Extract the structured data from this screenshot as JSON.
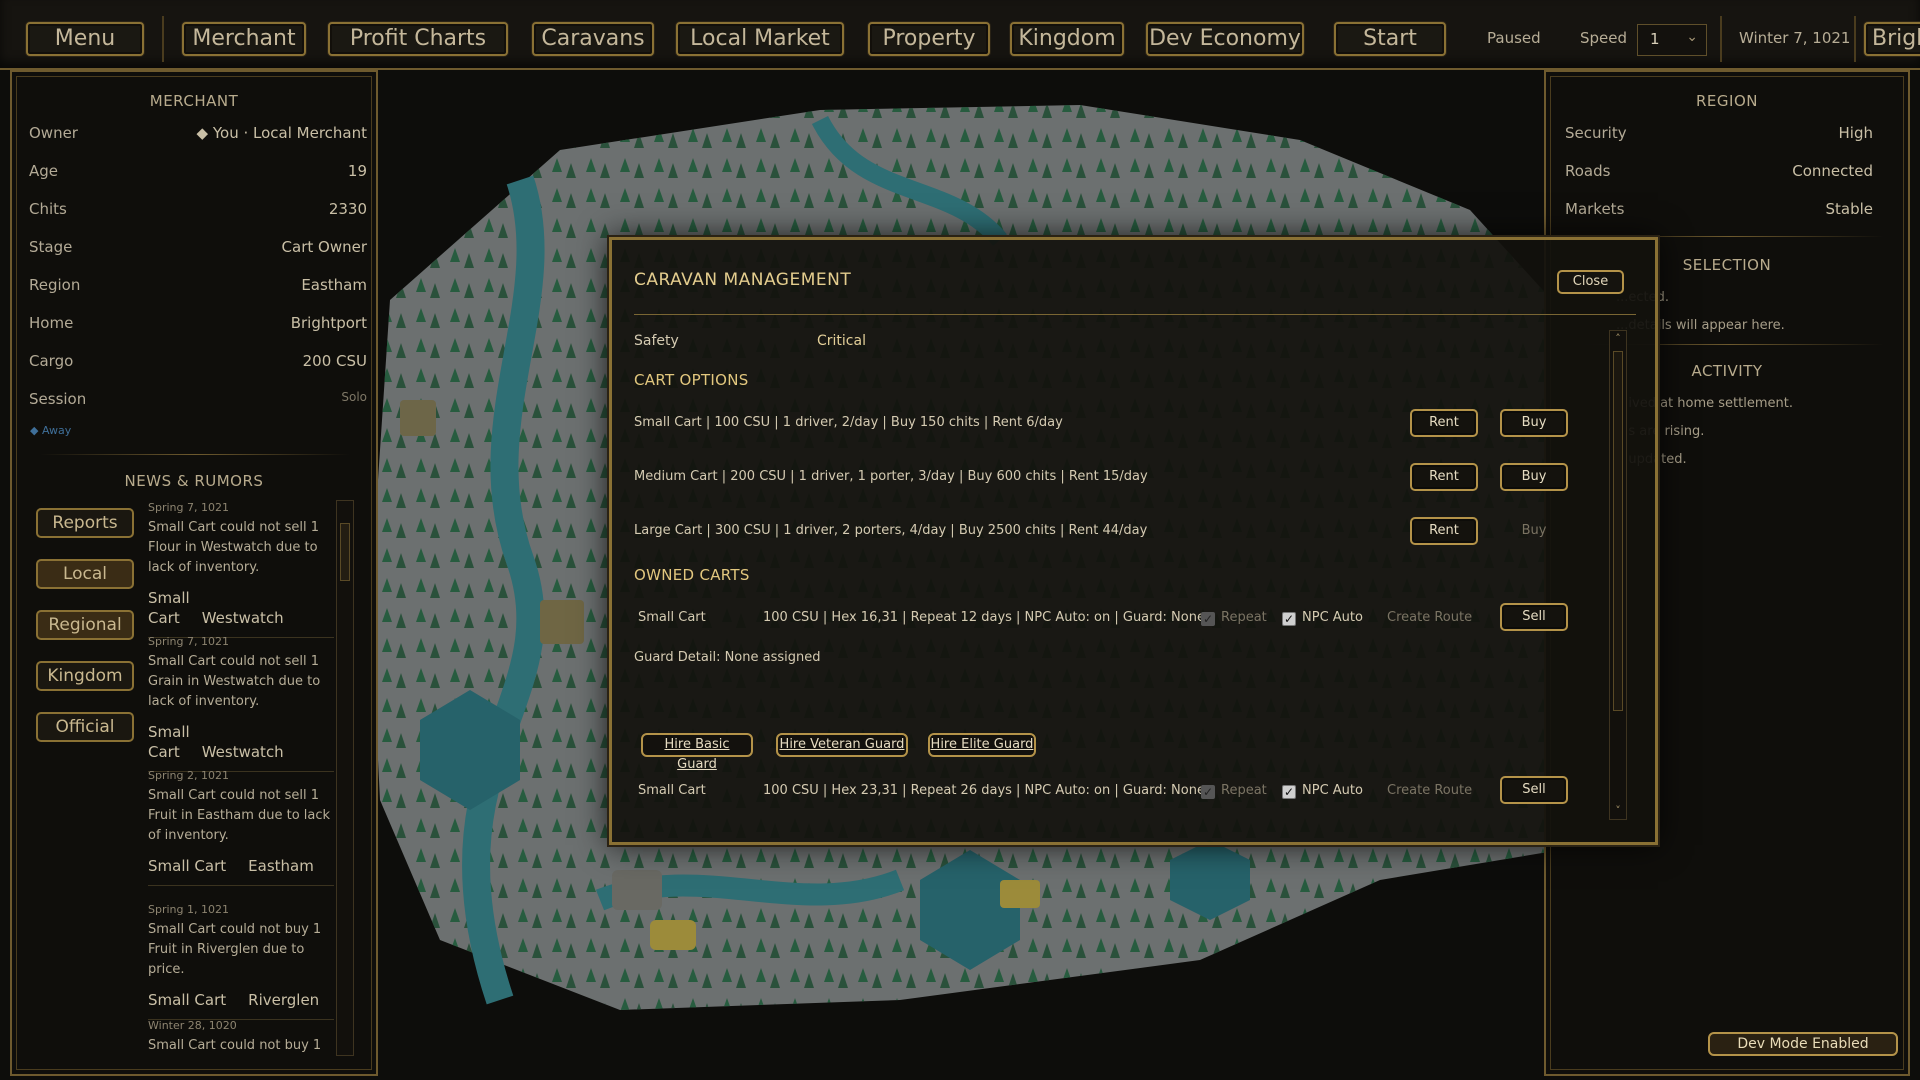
{
  "topbar": {
    "nav": [
      "Menu",
      "Merchant",
      "Profit Charts",
      "Caravans",
      "Local Market",
      "Property",
      "Kingdom",
      "Dev Economy",
      "Start"
    ],
    "status": "Paused",
    "speed_label": "Speed",
    "speed_value": "1",
    "date": "Winter 7, 1021",
    "location_partial": "Brigh"
  },
  "merchant": {
    "heading": "MERCHANT",
    "rows": [
      {
        "k": "Owner",
        "v": "◆ You · Local Merchant"
      },
      {
        "k": "Age",
        "v": "19"
      },
      {
        "k": "Chits",
        "v": "2330"
      },
      {
        "k": "Stage",
        "v": "Cart Owner"
      },
      {
        "k": "Region",
        "v": "Eastham"
      },
      {
        "k": "Home",
        "v": "Brightport"
      },
      {
        "k": "Cargo",
        "v": "200 CSU"
      },
      {
        "k": "Session",
        "v": "Solo"
      }
    ],
    "away": "◆ Away"
  },
  "news": {
    "heading": "NEWS & RUMORS",
    "filters": [
      "Reports",
      "Local",
      "Regional",
      "Kingdom",
      "Official"
    ],
    "items": [
      {
        "date": "Spring 7, 1021",
        "text": "Small Cart could not sell 1 Flour in Westwatch due to lack of inventory.",
        "tags": [
          "Small Cart",
          "Westwatch"
        ]
      },
      {
        "date": "Spring 7, 1021",
        "text": "Small Cart could not sell 1 Grain in Westwatch due to lack of inventory.",
        "tags": [
          "Small Cart",
          "Westwatch"
        ]
      },
      {
        "date": "Spring 2, 1021",
        "text": "Small Cart could not sell 1 Fruit in Eastham due to lack of inventory.",
        "tags": [
          "Small Cart",
          "Eastham"
        ]
      },
      {
        "date": "Spring 1, 1021",
        "text": "Small Cart could not buy 1 Fruit in Riverglen due to price.",
        "tags": [
          "Small Cart",
          "Riverglen"
        ]
      },
      {
        "date": "Winter 28, 1020",
        "text": "Small Cart could not buy 1",
        "tags": []
      }
    ]
  },
  "region": {
    "heading": "REGION",
    "rows": [
      {
        "k": "Security",
        "v": "High"
      },
      {
        "k": "Roads",
        "v": "Connected"
      },
      {
        "k": "Markets",
        "v": "Stable"
      }
    ],
    "selection_heading": "SELECTION",
    "selection_lines": [
      "...ected.",
      "...details will appear here."
    ],
    "activity_heading": "ACTIVITY",
    "activity_lines": [
      "...ived at home settlement.",
      "...s are rising.",
      "...updated."
    ],
    "dev_mode": "Dev Mode Enabled"
  },
  "caravan": {
    "title": "CARAVAN MANAGEMENT",
    "close": "Close",
    "safety_label": "Safety",
    "safety_value": "Critical",
    "cart_options_heading": "CART OPTIONS",
    "options": [
      {
        "desc": "Small Cart | 100 CSU | 1 driver, 2/day | Buy 150 chits | Rent 6/day",
        "rent": "Rent",
        "buy": "Buy",
        "buy_enabled": true
      },
      {
        "desc": "Medium Cart | 200 CSU | 1 driver, 1 porter, 3/day | Buy 600 chits | Rent 15/day",
        "rent": "Rent",
        "buy": "Buy",
        "buy_enabled": true
      },
      {
        "desc": "Large Cart | 300 CSU | 1 driver, 2 porters, 4/day | Buy 2500 chits | Rent 44/day",
        "rent": "Rent",
        "buy": "Buy",
        "buy_enabled": false
      }
    ],
    "owned_heading": "OWNED CARTS",
    "owned": [
      {
        "name": "Small Cart",
        "details": "100 CSU | Hex 16,31 | Repeat 12 days | NPC Auto: on | Guard: None",
        "repeat": "Repeat",
        "npc": "NPC Auto",
        "create_route": "Create Route",
        "sell": "Sell",
        "guard_detail": "Guard Detail: None assigned"
      },
      {
        "name": "Small Cart",
        "details": "100 CSU | Hex 23,31 | Repeat 26 days | NPC Auto: on | Guard: None",
        "repeat": "Repeat",
        "npc": "NPC Auto",
        "create_route": "Create Route",
        "sell": "Sell"
      }
    ],
    "guard_buttons": [
      "Hire Basic Guard",
      "Hire Veteran Guard",
      "Hire Elite Guard"
    ]
  }
}
